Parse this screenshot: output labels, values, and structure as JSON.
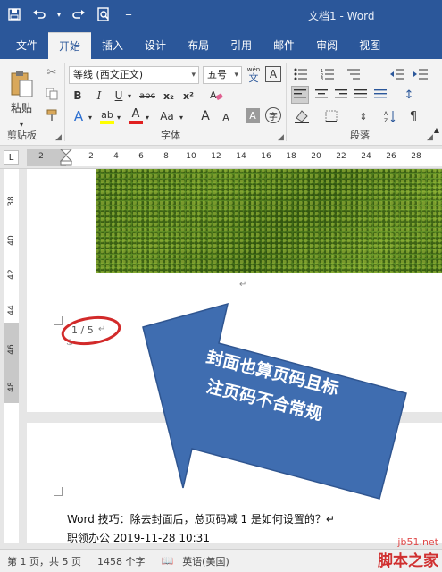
{
  "window": {
    "title": "文档1 - Word"
  },
  "tabs": [
    {
      "label": "文件"
    },
    {
      "label": "开始"
    },
    {
      "label": "插入"
    },
    {
      "label": "设计"
    },
    {
      "label": "布局"
    },
    {
      "label": "引用"
    },
    {
      "label": "邮件"
    },
    {
      "label": "审阅"
    },
    {
      "label": "视图"
    }
  ],
  "ribbon": {
    "clipboard": {
      "paste_label": "粘贴",
      "group_label": "剪贴板"
    },
    "font": {
      "font_name": "等线 (西文正文)",
      "font_size": "五号",
      "phonetic": "wén",
      "phonetic_char": "文",
      "border_char": "A",
      "bold": "B",
      "italic": "I",
      "underline": "U",
      "strike": "abc",
      "subscript": "x₂",
      "superscript": "x²",
      "effects": "A",
      "highlight": "ab",
      "font_color": "A",
      "change_case": "Aa",
      "grow": "A",
      "shrink": "A",
      "char_shading": "A",
      "enclose": "字",
      "group_label": "字体"
    },
    "paragraph": {
      "group_label": "段落"
    }
  },
  "ruler": {
    "h_numbers": [
      "2",
      "2",
      "4",
      "6",
      "8",
      "10",
      "12",
      "14",
      "16",
      "18",
      "20",
      "22",
      "24",
      "26",
      "28"
    ],
    "v_numbers": [
      "38",
      "40",
      "42",
      "44",
      "46",
      "48"
    ],
    "tab_stop": "L"
  },
  "document": {
    "page_number": "1 / 5",
    "line1": "Word 技巧：除去封面后，总页码减 1 是如何设置的？↵",
    "line2": "职领办公 2019-11-28 10:31",
    "callout": "封面也算页码且标注页码不合常规"
  },
  "statusbar": {
    "page": "第 1 页，共 5 页",
    "words": "1458 个字",
    "language": "英语(美国)"
  },
  "watermark": {
    "site": "jb51.net",
    "name": "脚本之家"
  },
  "colors": {
    "ribbon_blue": "#2b579a",
    "callout_blue": "#3f6db0",
    "circle_red": "#d22a2a"
  }
}
